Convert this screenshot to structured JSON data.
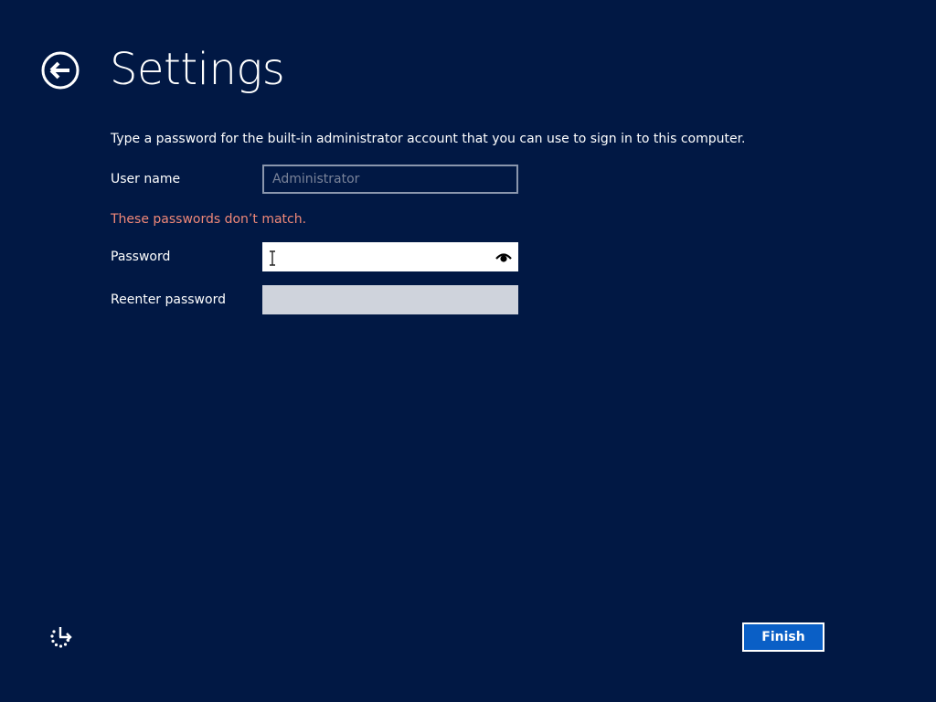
{
  "header": {
    "title": "Settings",
    "back_icon": "back-arrow-icon"
  },
  "form": {
    "instruction": "Type a password for the built-in administrator account that you can use to sign in to this computer.",
    "username": {
      "label": "User name",
      "placeholder": "Administrator",
      "value": ""
    },
    "error": "These passwords don’t match.",
    "password": {
      "label": "Password",
      "value": "",
      "reveal_icon": "eye-icon"
    },
    "reenter": {
      "label": "Reenter password",
      "value": ""
    }
  },
  "footer": {
    "accessibility_icon": "ease-of-access-icon",
    "finish_label": "Finish"
  },
  "colors": {
    "background": "#011844",
    "error": "#f08878",
    "accent": "#0a5fc6"
  }
}
